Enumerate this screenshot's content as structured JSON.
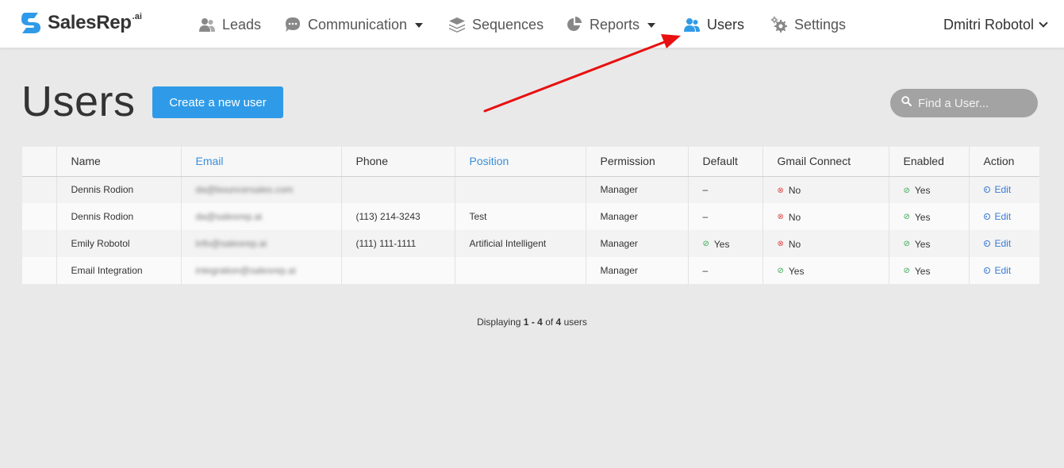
{
  "app": {
    "brand": "SalesRep",
    "brand_suffix": ".ai",
    "brand_color": "#2f9be8"
  },
  "nav": {
    "items": [
      {
        "label": "Leads",
        "icon": "users-icon"
      },
      {
        "label": "Communication",
        "icon": "chat-icon"
      },
      {
        "label": "Sequences",
        "icon": "layers-icon"
      },
      {
        "label": "Reports",
        "icon": "pie-chart-icon"
      },
      {
        "label": "Users",
        "icon": "user-group-icon"
      },
      {
        "label": "Settings",
        "icon": "gear-icon"
      }
    ],
    "active": "Users",
    "user_name": "Dmitri Robotol"
  },
  "page": {
    "title": "Users",
    "create_button": "Create a new user",
    "search_placeholder": "Find a User..."
  },
  "table": {
    "columns": [
      "",
      "Name",
      "Email",
      "Phone",
      "Position",
      "Permission",
      "Default",
      "Gmail Connect",
      "Enabled",
      "Action"
    ],
    "sortable_columns": [
      "Email",
      "Position"
    ],
    "rows": [
      {
        "name": "Dennis Rodion",
        "email": "da@bouncersales.com",
        "phone": "",
        "position": "",
        "permission": "Manager",
        "default": "–",
        "gmail": "No",
        "enabled": "Yes",
        "action": "Edit"
      },
      {
        "name": "Dennis Rodion",
        "email": "da@salesrep.ai",
        "phone": "(113) 214-3243",
        "position": "Test",
        "permission": "Manager",
        "default": "–",
        "gmail": "No",
        "enabled": "Yes",
        "action": "Edit"
      },
      {
        "name": "Emily Robotol",
        "email": "info@salesrep.ai",
        "phone": "(111) 111-1111",
        "position": "Artificial Intelligent",
        "permission": "Manager",
        "default": "Yes",
        "gmail": "No",
        "enabled": "Yes",
        "action": "Edit"
      },
      {
        "name": "Email Integration",
        "email": "integration@salesrep.ai",
        "phone": "",
        "position": "",
        "permission": "Manager",
        "default": "–",
        "gmail": "Yes",
        "enabled": "Yes",
        "action": "Edit"
      }
    ]
  },
  "pager": {
    "prefix": "Displaying",
    "from": "1",
    "sep": "-",
    "to": "4",
    "of_word": "of",
    "total": "4",
    "suffix": "users"
  },
  "colors": {
    "accent": "#2f9be8",
    "link": "#3a8fd8",
    "ok": "#34a853",
    "error": "#e04848",
    "arrow": "#e81010"
  }
}
